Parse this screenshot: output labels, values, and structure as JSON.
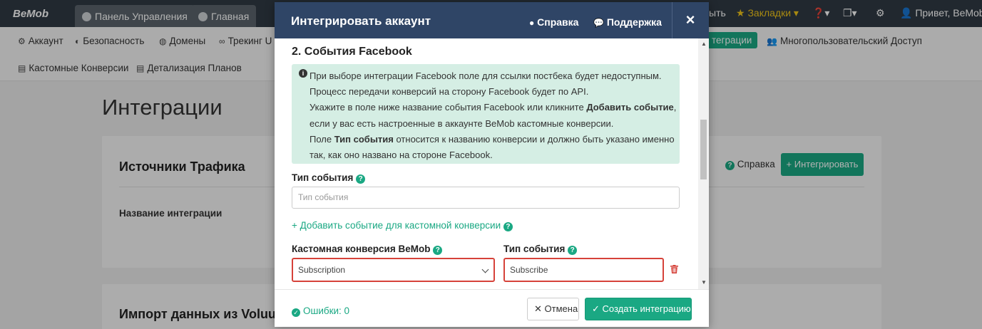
{
  "topnav": {
    "logo": "BeMob",
    "tabs": [
      {
        "label": "Панель Управления"
      },
      {
        "label": "Главная"
      }
    ],
    "right": {
      "partial_label": "ыть",
      "bookmarks": "Закладки",
      "greeting": "Привет, BeMob"
    }
  },
  "subnav": {
    "items": [
      {
        "label": "Аккаунт"
      },
      {
        "label": "Безопасность"
      },
      {
        "label": "Домены"
      },
      {
        "label": "Трекинг U"
      },
      {
        "label": "теграции"
      },
      {
        "label": "Многопользовательский Доступ"
      },
      {
        "label": "Кастомные Конверсии"
      },
      {
        "label": "Детализация Планов"
      }
    ]
  },
  "page": {
    "title": "Интеграции",
    "traffic_card": {
      "title": "Источники Трафика",
      "col_header": "Название интеграции",
      "help": "Справка",
      "integrate": "+ Интегрировать"
    },
    "import_card": {
      "title": "Импорт данных из Voluu"
    }
  },
  "modal": {
    "title": "Интегрировать аккаунт",
    "help_link": "Справка",
    "support_link": "Поддержка",
    "close": "×",
    "section_title": "2. События Facebook",
    "info_lines": [
      {
        "text": "При выборе интеграции Facebook поле для ссылки постбека будет недоступным."
      },
      {
        "text": "Процесс передачи конверсий на сторону Facebook будет по API."
      },
      {
        "pre": "Укажите в поле ниже название события Facebook или кликните ",
        "bold": "Добавить событие",
        "post": ","
      },
      {
        "text": "если у вас есть настроенные в аккаунте BeMob кастомные конверсии."
      },
      {
        "pre": "Поле ",
        "bold": "Тип события",
        "post": " относится к названию конверсии и должно быть указано именно"
      },
      {
        "text": "так, как оно названо на стороне Facebook."
      }
    ],
    "event_type_label": "Тип события",
    "event_type_placeholder": "Тип события",
    "add_custom_link": "+ Добавить событие для кастомной конверсии",
    "custom_conv_label": "Кастомная конверсия BeMob",
    "custom_event_label": "Тип события",
    "custom_conv_value": "Subscription",
    "custom_event_value": "Subscribe",
    "errors": "Ошибки: 0",
    "cancel": "Отмена",
    "create": "Создать интеграцию"
  },
  "colors": {
    "accent": "#1aa883",
    "header": "#2f4566",
    "error": "#d6423a",
    "info_bg": "#d5eee4"
  }
}
